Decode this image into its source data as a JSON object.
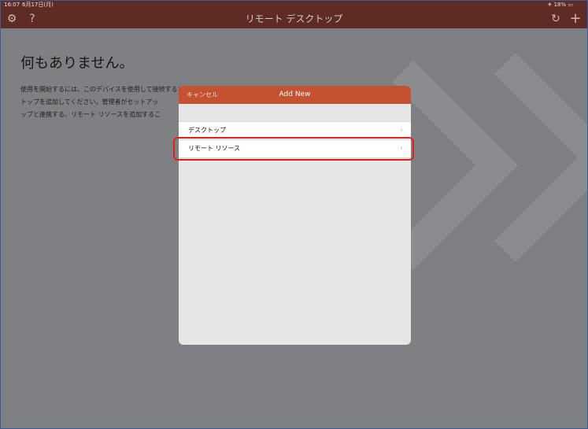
{
  "status_bar": {
    "time": "16:07",
    "date": "6月17日(月)",
    "right": "✈ 18% ▭"
  },
  "nav": {
    "title": "リモート デスクトップ",
    "settings_icon": "⚙",
    "help_icon": "?",
    "refresh_icon": "↻",
    "add_icon": "+"
  },
  "content": {
    "heading": "何もありません。",
    "description_lines": [
      "使用を開始するには、このデバイスを使用して接続するリモー デスク",
      "トップを追加してください。管理者がセットアッ",
      "ップと連携する、リモート リソースを追加するこ"
    ]
  },
  "modal": {
    "cancel_label": "キャンセル",
    "title": "Add New",
    "items": [
      {
        "label": "デスクトップ",
        "chevron": "›"
      },
      {
        "label": "リモート リソース",
        "chevron": "›"
      }
    ]
  }
}
